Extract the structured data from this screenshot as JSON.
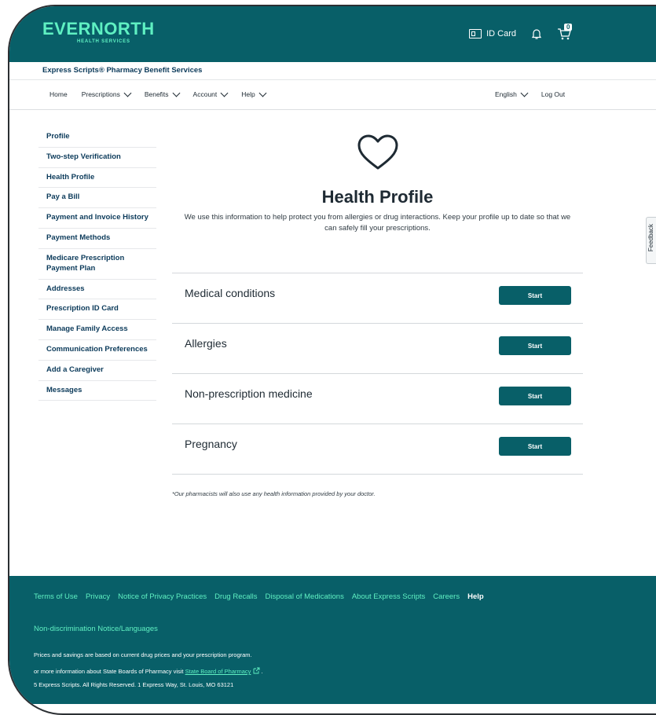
{
  "header": {
    "logo": "EVERNORTH",
    "logo_sub": "HEALTH SERVICES",
    "id_card_label": "ID Card",
    "cart_count": "0",
    "brand_line": "Express Scripts® Pharmacy Benefit Services"
  },
  "nav": {
    "left": [
      "Home",
      "Prescriptions",
      "Benefits",
      "Account",
      "Help"
    ],
    "language": "English",
    "logout": "Log Out"
  },
  "sidebar": {
    "items": [
      {
        "label": "Profile"
      },
      {
        "label": "Two-step Verification"
      },
      {
        "label": "Health Profile"
      },
      {
        "label": "Pay a Bill"
      },
      {
        "label": "Payment and Invoice History"
      },
      {
        "label": "Payment Methods"
      },
      {
        "label": "Medicare Prescription Payment Plan"
      },
      {
        "label": "Addresses"
      },
      {
        "label": "Prescription ID Card"
      },
      {
        "label": "Manage Family Access"
      },
      {
        "label": "Communication Preferences"
      },
      {
        "label": "Add a Caregiver"
      },
      {
        "label": "Messages"
      }
    ]
  },
  "main": {
    "title": "Health Profile",
    "description": "We use this information to help protect you from allergies or drug interactions. Keep your profile up to date so that we can safely fill your prescriptions.",
    "sections": [
      {
        "label": "Medical conditions",
        "button": "Start"
      },
      {
        "label": "Allergies",
        "button": "Start"
      },
      {
        "label": "Non-prescription medicine",
        "button": "Start"
      },
      {
        "label": "Pregnancy",
        "button": "Start"
      }
    ],
    "note": "*Our pharmacists will also use any health information provided by your doctor."
  },
  "feedback": "Feedback",
  "footer": {
    "links": [
      "Terms of Use",
      "Privacy",
      "Notice of Privacy Practices",
      "Drug Recalls",
      "Disposal of Medications",
      "About Express Scripts",
      "Careers"
    ],
    "help": "Help",
    "nondiscrimination": "Non-discrimination Notice/Languages",
    "prices": "Prices and savings are based on current drug prices and your prescription program.",
    "boards_prefix": "or more information about State Boards of Pharmacy visit",
    "boards_link": "State Board of Pharmacy",
    "copyright": "5 Express Scripts. All Rights Reserved. 1 Express Way, St. Louis, MO 63121"
  },
  "colors": {
    "brand": "#085f68",
    "accent": "#5ff0c2"
  }
}
